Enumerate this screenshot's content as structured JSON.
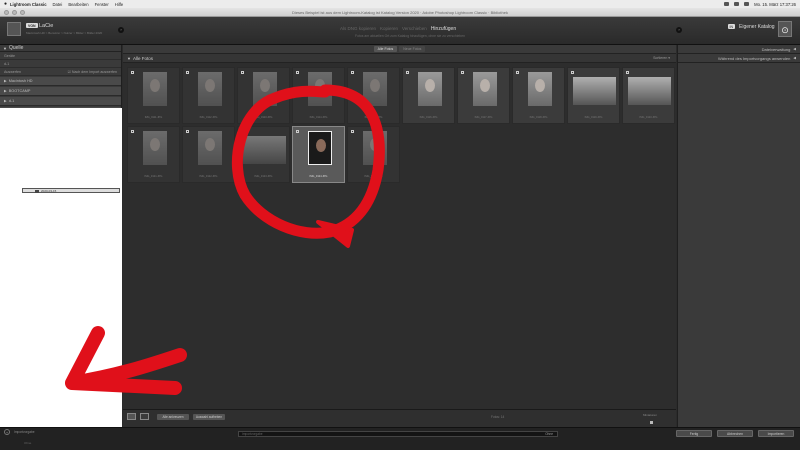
{
  "menubar": {
    "app_name": "Lightroom Classic",
    "items": [
      "Datei",
      "Bearbeiten",
      "Fenster",
      "Hilfe"
    ],
    "clock": "Mo. 15. März 17:37:26"
  },
  "window": {
    "title": "Dieses Beispiel ist aus dem Lightroom-Katalog ist Katalog Version 2020 · Adobe Photoshop Lightroom Classic · Bibliothek"
  },
  "import_header": {
    "source_button": "VON",
    "source_label": "LaCie",
    "source_path": "Macintosh HD > Benutzer > Nutzer > Bilder > Bilder 2020",
    "modes": [
      "Als DNG kopieren",
      "Kopieren",
      "Verschieben",
      "Hinzufügen"
    ],
    "modes_subtitle": "Fotos am aktuellen Ort zum Katalog hinzufügen, ohne sie zu verschieben",
    "dest_button": "IN",
    "dest_label": "Eigener Katalog"
  },
  "left_panel": {
    "header": "Quelle",
    "devices_label": "Geräte",
    "device_name": "d-1",
    "eject_label": "Auswerfen",
    "eject_option": "Nach dem Import auswerfen",
    "sections": [
      "Macintosh HD",
      "BOOTCAMP",
      "d-1",
      "LaCie"
    ],
    "tree": [
      "Backup Mac Book Pro",
      "Fotoarchiv",
      "2020"
    ],
    "selected_folder": "2020-03-15"
  },
  "center": {
    "toggle_all": "Alle Fotos",
    "toggle_new": "Neue Fotos",
    "grid_title": "Alle Fotos",
    "sort_label": "Sortieren"
  },
  "bottom_bar": {
    "check_all": "Alle ankreuzen",
    "uncheck_all": "Auswahl aufheben",
    "count_label": "Fotos: 14",
    "thumb_label": "Miniaturen"
  },
  "right_panel": {
    "rows": [
      "Dateiverwaltung",
      "Während des Importvorgangs anwenden"
    ]
  },
  "footer": {
    "preset_label": "Importvorgabe",
    "preset_value": "Ohne",
    "search_text": "Importvorgabe",
    "search_end": "Ohne",
    "cancel": "Fertig",
    "back": "Abbrechen",
    "import": "Importieren"
  },
  "thumbnails": [
    {
      "caption": "IMG_0111.JPG",
      "orientation": "portrait",
      "state": "dim"
    },
    {
      "caption": "IMG_0112.JPG",
      "orientation": "portrait",
      "state": "dim"
    },
    {
      "caption": "IMG_0113.JPG",
      "orientation": "portrait",
      "state": "dim"
    },
    {
      "caption": "IMG_0114.JPG",
      "orientation": "portrait",
      "state": "dim"
    },
    {
      "caption": "IMG_0115.JPG",
      "orientation": "portrait",
      "state": "dim"
    },
    {
      "caption": "IMG_0116.JPG",
      "orientation": "portrait",
      "state": "normal"
    },
    {
      "caption": "IMG_0117.JPG",
      "orientation": "portrait",
      "state": "normal"
    },
    {
      "caption": "IMG_0118.JPG",
      "orientation": "portrait",
      "state": "normal"
    },
    {
      "caption": "IMG_0119.JPG",
      "orientation": "landscape",
      "state": "normal"
    },
    {
      "caption": "IMG_0120.JPG",
      "orientation": "landscape",
      "state": "normal"
    },
    {
      "caption": "IMG_0121.JPG",
      "orientation": "portrait",
      "state": "dim"
    },
    {
      "caption": "IMG_0122.JPG",
      "orientation": "portrait",
      "state": "dim"
    },
    {
      "caption": "IMG_0123.JPG",
      "orientation": "landscape",
      "state": "dim"
    },
    {
      "caption": "IMG_0124.JPG",
      "orientation": "portrait",
      "state": "selected"
    },
    {
      "caption": "IMG_0125.JPG",
      "orientation": "portrait",
      "state": "dim"
    }
  ],
  "colors": {
    "annotation_red": "#e0101a",
    "panel_bg": "#3a3a3a",
    "grid_bg": "#2d2d2d"
  }
}
